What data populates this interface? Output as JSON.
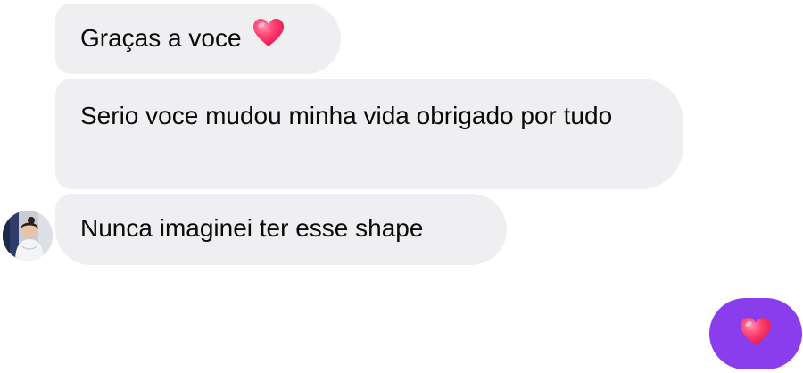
{
  "conversation": {
    "received_messages": [
      {
        "text": "Graças a voce",
        "emoji": "heart-emoji"
      },
      {
        "text": "Serio voce mudou minha vida obrigado por tudo"
      },
      {
        "text": "Nunca imaginei ter esse shape"
      }
    ],
    "sent_message": {
      "emoji": "heart-emoji"
    }
  },
  "colors": {
    "received_bubble": "#efeff2",
    "sent_bubble": "#8a3ded",
    "text": "#0a0a0a",
    "heart": "#ff3d6e"
  },
  "icons": {
    "contact_avatar": "avatar"
  }
}
